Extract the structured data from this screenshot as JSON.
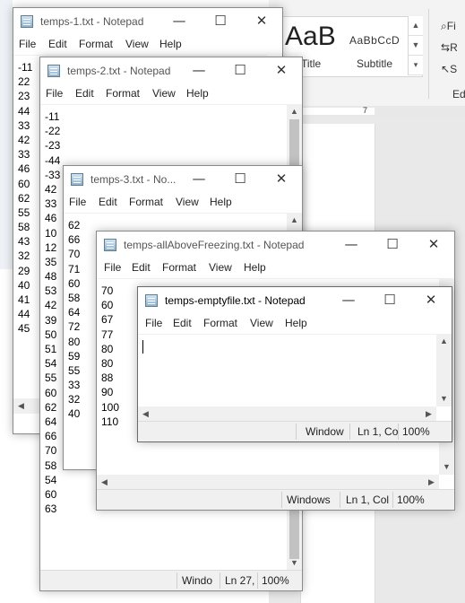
{
  "word": {
    "style_sample_title": "AaB",
    "style_sample_subtitle": "AaBbCcD",
    "style_title": "Title",
    "style_subtitle": "Subtitle",
    "ribbon_find": "Fi",
    "ribbon_replace": "R",
    "ribbon_select": "S",
    "ribbon_editing": "Ed",
    "ruler_mark": "7"
  },
  "menu": {
    "file": "File",
    "edit": "Edit",
    "format": "Format",
    "view": "View",
    "help": "Help"
  },
  "window_buttons": {
    "minimize": "—",
    "maximize": "☐",
    "close": "✕"
  },
  "windows": [
    {
      "title": "temps-1.txt - Notepad",
      "lines": [
        "-11",
        "22",
        "23",
        "44",
        "33",
        "42",
        "33",
        "46",
        "60",
        "62",
        "55",
        "58",
        "43",
        "32",
        "29",
        "40",
        "41",
        "44",
        "45"
      ]
    },
    {
      "title": "temps-2.txt - Notepad",
      "lines": [
        "-11",
        "-22",
        "-23",
        "-44",
        "-33",
        "42",
        "33",
        "46",
        "10",
        "12",
        "35",
        "48",
        "53",
        "42",
        "39",
        "50",
        "51",
        "54",
        "55",
        "60",
        "62",
        "64",
        "66",
        "70",
        "58",
        "54",
        "60",
        "63"
      ],
      "status": {
        "encoding": "Windo",
        "position": "Ln 27,",
        "zoom": "100%"
      }
    },
    {
      "title": "temps-3.txt - No...",
      "lines": [
        "62",
        "66",
        "70",
        "71",
        "60",
        "58",
        "64",
        "72",
        "80",
        "59",
        "55",
        "33",
        "32",
        "40"
      ]
    },
    {
      "title": "temps-allAboveFreezing.txt - Notepad",
      "lines": [
        "70",
        "60",
        "67",
        "77",
        "80",
        "80",
        "88",
        "90",
        "100",
        "110"
      ],
      "status": {
        "encoding": "Windows",
        "position": "Ln 1, Col 1",
        "zoom": "100%"
      }
    },
    {
      "title": "temps-emptyfile.txt - Notepad",
      "lines": [],
      "status": {
        "encoding": "Window",
        "position": "Ln 1, Co",
        "zoom": "100%"
      }
    }
  ]
}
